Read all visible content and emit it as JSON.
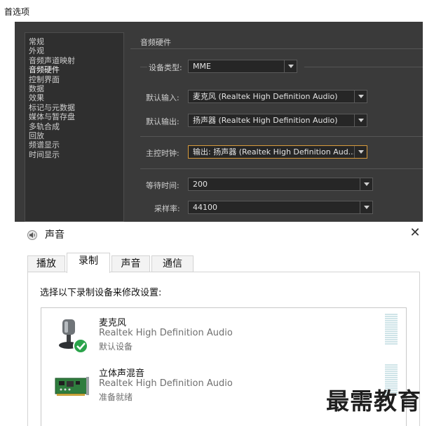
{
  "preferences": {
    "title": "首选项",
    "sidebar_items": [
      "常规",
      "外观",
      "音频声道映射",
      "音频硬件",
      "控制界面",
      "数据",
      "效果",
      "标记与元数据",
      "媒体与暂存盘",
      "多轨合成",
      "回放",
      "频谱显示",
      "时间显示"
    ],
    "active_item": "音频硬件",
    "section_title": "音频硬件",
    "device_type": {
      "label": "设备类型:",
      "value": "MME"
    },
    "default_input": {
      "label": "默认输入:",
      "value": "麦克风 (Realtek High Definition Audio)"
    },
    "default_output": {
      "label": "默认输出:",
      "value": "扬声器 (Realtek High Definition Audio)"
    },
    "master_clock": {
      "label": "主控时钟:",
      "value": "输出: 扬声器 (Realtek High Definition Aud..."
    },
    "latency": {
      "label": "等待时间:",
      "value": "200"
    },
    "sample_rate": {
      "label": "采样率:",
      "value": "44100"
    },
    "accent_color": "#d79a3c"
  },
  "sound_dialog": {
    "title": "声音",
    "close_glyph": "✕",
    "tabs": [
      "播放",
      "录制",
      "声音",
      "通信"
    ],
    "active_tab": "录制",
    "instruction": "选择以下录制设备来修改设置:",
    "devices": [
      {
        "name": "麦克风",
        "description": "Realtek High Definition Audio",
        "status": "默认设备",
        "icon": "microphone-icon",
        "default": true
      },
      {
        "name": "立体声混音",
        "description": "Realtek High Definition Audio",
        "status": "准备就绪",
        "icon": "sound-card-icon",
        "default": false
      }
    ],
    "default_badge_color": "#2aa34a"
  },
  "watermark": "最需教育"
}
